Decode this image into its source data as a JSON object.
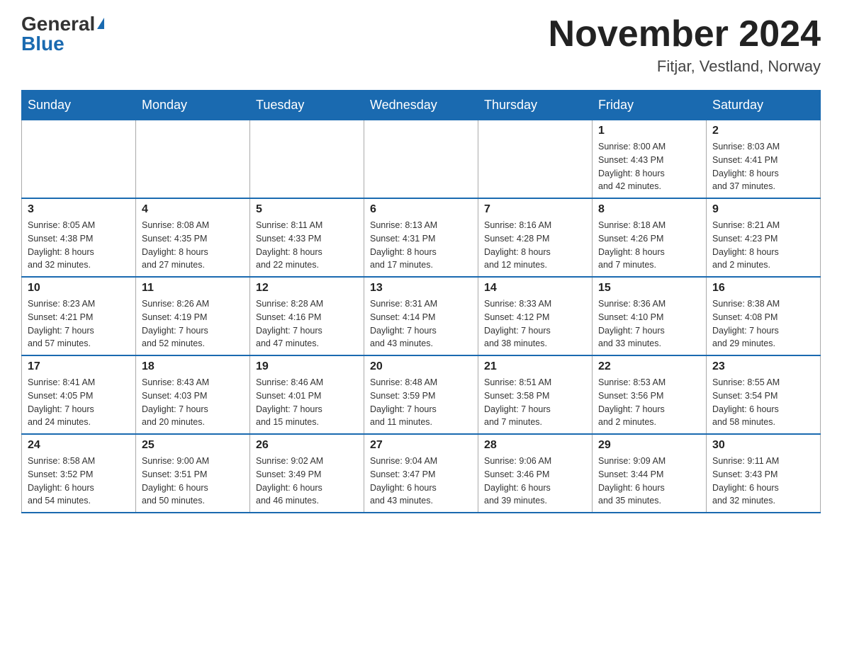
{
  "header": {
    "logo_general": "General",
    "logo_blue": "Blue",
    "month_title": "November 2024",
    "location": "Fitjar, Vestland, Norway"
  },
  "weekdays": [
    "Sunday",
    "Monday",
    "Tuesday",
    "Wednesday",
    "Thursday",
    "Friday",
    "Saturday"
  ],
  "weeks": [
    [
      {
        "day": "",
        "info": ""
      },
      {
        "day": "",
        "info": ""
      },
      {
        "day": "",
        "info": ""
      },
      {
        "day": "",
        "info": ""
      },
      {
        "day": "",
        "info": ""
      },
      {
        "day": "1",
        "info": "Sunrise: 8:00 AM\nSunset: 4:43 PM\nDaylight: 8 hours\nand 42 minutes."
      },
      {
        "day": "2",
        "info": "Sunrise: 8:03 AM\nSunset: 4:41 PM\nDaylight: 8 hours\nand 37 minutes."
      }
    ],
    [
      {
        "day": "3",
        "info": "Sunrise: 8:05 AM\nSunset: 4:38 PM\nDaylight: 8 hours\nand 32 minutes."
      },
      {
        "day": "4",
        "info": "Sunrise: 8:08 AM\nSunset: 4:35 PM\nDaylight: 8 hours\nand 27 minutes."
      },
      {
        "day": "5",
        "info": "Sunrise: 8:11 AM\nSunset: 4:33 PM\nDaylight: 8 hours\nand 22 minutes."
      },
      {
        "day": "6",
        "info": "Sunrise: 8:13 AM\nSunset: 4:31 PM\nDaylight: 8 hours\nand 17 minutes."
      },
      {
        "day": "7",
        "info": "Sunrise: 8:16 AM\nSunset: 4:28 PM\nDaylight: 8 hours\nand 12 minutes."
      },
      {
        "day": "8",
        "info": "Sunrise: 8:18 AM\nSunset: 4:26 PM\nDaylight: 8 hours\nand 7 minutes."
      },
      {
        "day": "9",
        "info": "Sunrise: 8:21 AM\nSunset: 4:23 PM\nDaylight: 8 hours\nand 2 minutes."
      }
    ],
    [
      {
        "day": "10",
        "info": "Sunrise: 8:23 AM\nSunset: 4:21 PM\nDaylight: 7 hours\nand 57 minutes."
      },
      {
        "day": "11",
        "info": "Sunrise: 8:26 AM\nSunset: 4:19 PM\nDaylight: 7 hours\nand 52 minutes."
      },
      {
        "day": "12",
        "info": "Sunrise: 8:28 AM\nSunset: 4:16 PM\nDaylight: 7 hours\nand 47 minutes."
      },
      {
        "day": "13",
        "info": "Sunrise: 8:31 AM\nSunset: 4:14 PM\nDaylight: 7 hours\nand 43 minutes."
      },
      {
        "day": "14",
        "info": "Sunrise: 8:33 AM\nSunset: 4:12 PM\nDaylight: 7 hours\nand 38 minutes."
      },
      {
        "day": "15",
        "info": "Sunrise: 8:36 AM\nSunset: 4:10 PM\nDaylight: 7 hours\nand 33 minutes."
      },
      {
        "day": "16",
        "info": "Sunrise: 8:38 AM\nSunset: 4:08 PM\nDaylight: 7 hours\nand 29 minutes."
      }
    ],
    [
      {
        "day": "17",
        "info": "Sunrise: 8:41 AM\nSunset: 4:05 PM\nDaylight: 7 hours\nand 24 minutes."
      },
      {
        "day": "18",
        "info": "Sunrise: 8:43 AM\nSunset: 4:03 PM\nDaylight: 7 hours\nand 20 minutes."
      },
      {
        "day": "19",
        "info": "Sunrise: 8:46 AM\nSunset: 4:01 PM\nDaylight: 7 hours\nand 15 minutes."
      },
      {
        "day": "20",
        "info": "Sunrise: 8:48 AM\nSunset: 3:59 PM\nDaylight: 7 hours\nand 11 minutes."
      },
      {
        "day": "21",
        "info": "Sunrise: 8:51 AM\nSunset: 3:58 PM\nDaylight: 7 hours\nand 7 minutes."
      },
      {
        "day": "22",
        "info": "Sunrise: 8:53 AM\nSunset: 3:56 PM\nDaylight: 7 hours\nand 2 minutes."
      },
      {
        "day": "23",
        "info": "Sunrise: 8:55 AM\nSunset: 3:54 PM\nDaylight: 6 hours\nand 58 minutes."
      }
    ],
    [
      {
        "day": "24",
        "info": "Sunrise: 8:58 AM\nSunset: 3:52 PM\nDaylight: 6 hours\nand 54 minutes."
      },
      {
        "day": "25",
        "info": "Sunrise: 9:00 AM\nSunset: 3:51 PM\nDaylight: 6 hours\nand 50 minutes."
      },
      {
        "day": "26",
        "info": "Sunrise: 9:02 AM\nSunset: 3:49 PM\nDaylight: 6 hours\nand 46 minutes."
      },
      {
        "day": "27",
        "info": "Sunrise: 9:04 AM\nSunset: 3:47 PM\nDaylight: 6 hours\nand 43 minutes."
      },
      {
        "day": "28",
        "info": "Sunrise: 9:06 AM\nSunset: 3:46 PM\nDaylight: 6 hours\nand 39 minutes."
      },
      {
        "day": "29",
        "info": "Sunrise: 9:09 AM\nSunset: 3:44 PM\nDaylight: 6 hours\nand 35 minutes."
      },
      {
        "day": "30",
        "info": "Sunrise: 9:11 AM\nSunset: 3:43 PM\nDaylight: 6 hours\nand 32 minutes."
      }
    ]
  ]
}
